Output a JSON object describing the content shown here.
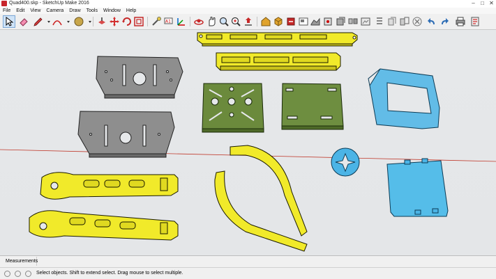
{
  "window": {
    "title": "Quad400.skp - SketchUp Make 2016",
    "minimize": "–",
    "maximize": "□",
    "close": "✕"
  },
  "menu": [
    "File",
    "Edit",
    "View",
    "Camera",
    "Draw",
    "Tools",
    "Window",
    "Help"
  ],
  "toolbar": {
    "tools": [
      "select-icon",
      "eraser-icon",
      "pencil-icon",
      "arc-icon",
      "paint-bucket-icon",
      "push-pull-icon",
      "move-icon",
      "rotate-icon",
      "offset-icon",
      "tape-measure-icon",
      "text-icon",
      "axes-icon",
      "orbit-icon",
      "pan-icon",
      "zoom-icon",
      "zoom-extents-icon",
      "previous-view-icon",
      "warehouse-icon",
      "components-icon",
      "extensions-icon",
      "layout-icon",
      "sandbox-icon",
      "undo-icon",
      "redo-icon",
      "print-icon",
      "model-info-icon"
    ]
  },
  "measurements": {
    "label": "Measurements",
    "value": ""
  },
  "status": {
    "message": "Select objects. Shift to extend select. Drag mouse to select multiple."
  },
  "colors": {
    "yellow": "#f1ea2a",
    "gray": "#8e8e8e",
    "green": "#6b8a3c",
    "blue": "#4bb4e6",
    "axis_red": "#c0392b"
  }
}
